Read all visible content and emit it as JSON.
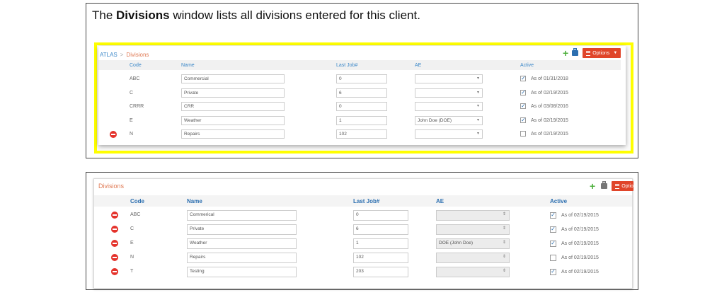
{
  "caption": {
    "pre": "The ",
    "bold": "Divisions",
    "post": " window lists all divisions entered for this client."
  },
  "shot1": {
    "breadcrumb": {
      "root": "ATLAS",
      "sep": ">",
      "current": "Divisions"
    },
    "options_label": "Options",
    "columns": {
      "code": "Code",
      "name": "Name",
      "lastjob": "Last Job#",
      "ae": "AE",
      "active": "Active"
    },
    "rows": [
      {
        "code": "ABC",
        "name": "Commercial",
        "lastjob": "0",
        "ae": "",
        "checked": true,
        "active": "As of 01/31/2018",
        "deletable": false
      },
      {
        "code": "C",
        "name": "Private",
        "lastjob": "6",
        "ae": "",
        "checked": true,
        "active": "As of 02/19/2015",
        "deletable": false
      },
      {
        "code": "CRRR",
        "name": "CRR",
        "lastjob": "0",
        "ae": "",
        "checked": true,
        "active": "As of 03/08/2016",
        "deletable": false
      },
      {
        "code": "E",
        "name": "Weather",
        "lastjob": "1",
        "ae": "John Doe (DOE)",
        "checked": true,
        "active": "As of 02/19/2015",
        "deletable": false
      },
      {
        "code": "N",
        "name": "Repairs",
        "lastjob": "102",
        "ae": "",
        "checked": false,
        "active": "As of 02/19/2015",
        "deletable": true
      }
    ]
  },
  "shot2": {
    "title": "Divisions",
    "options_label": "Optio",
    "columns": {
      "code": "Code",
      "name": "Name",
      "lastjob": "Last Job#",
      "ae": "AE",
      "active": "Active"
    },
    "rows": [
      {
        "code": "ABC",
        "name": "Commerical",
        "lastjob": "0",
        "ae": "",
        "checked": true,
        "active": "As of 02/19/2015"
      },
      {
        "code": "C",
        "name": "Private",
        "lastjob": "6",
        "ae": "",
        "checked": true,
        "active": "As of 02/19/2015"
      },
      {
        "code": "E",
        "name": "Weather",
        "lastjob": "1",
        "ae": "DOE (John Doe)",
        "checked": true,
        "active": "As of 02/19/2015"
      },
      {
        "code": "N",
        "name": "Repairs",
        "lastjob": "102",
        "ae": "",
        "checked": false,
        "active": "As of 02/19/2015"
      },
      {
        "code": "T",
        "name": "Testing",
        "lastjob": "203",
        "ae": "",
        "checked": true,
        "active": "As of 02/19/2015"
      }
    ]
  },
  "colors": {
    "accent": "#e0452a",
    "link": "#3a87c8",
    "add": "#4caf3b",
    "delete": "#e4322b",
    "highlight": "#ffff00"
  }
}
